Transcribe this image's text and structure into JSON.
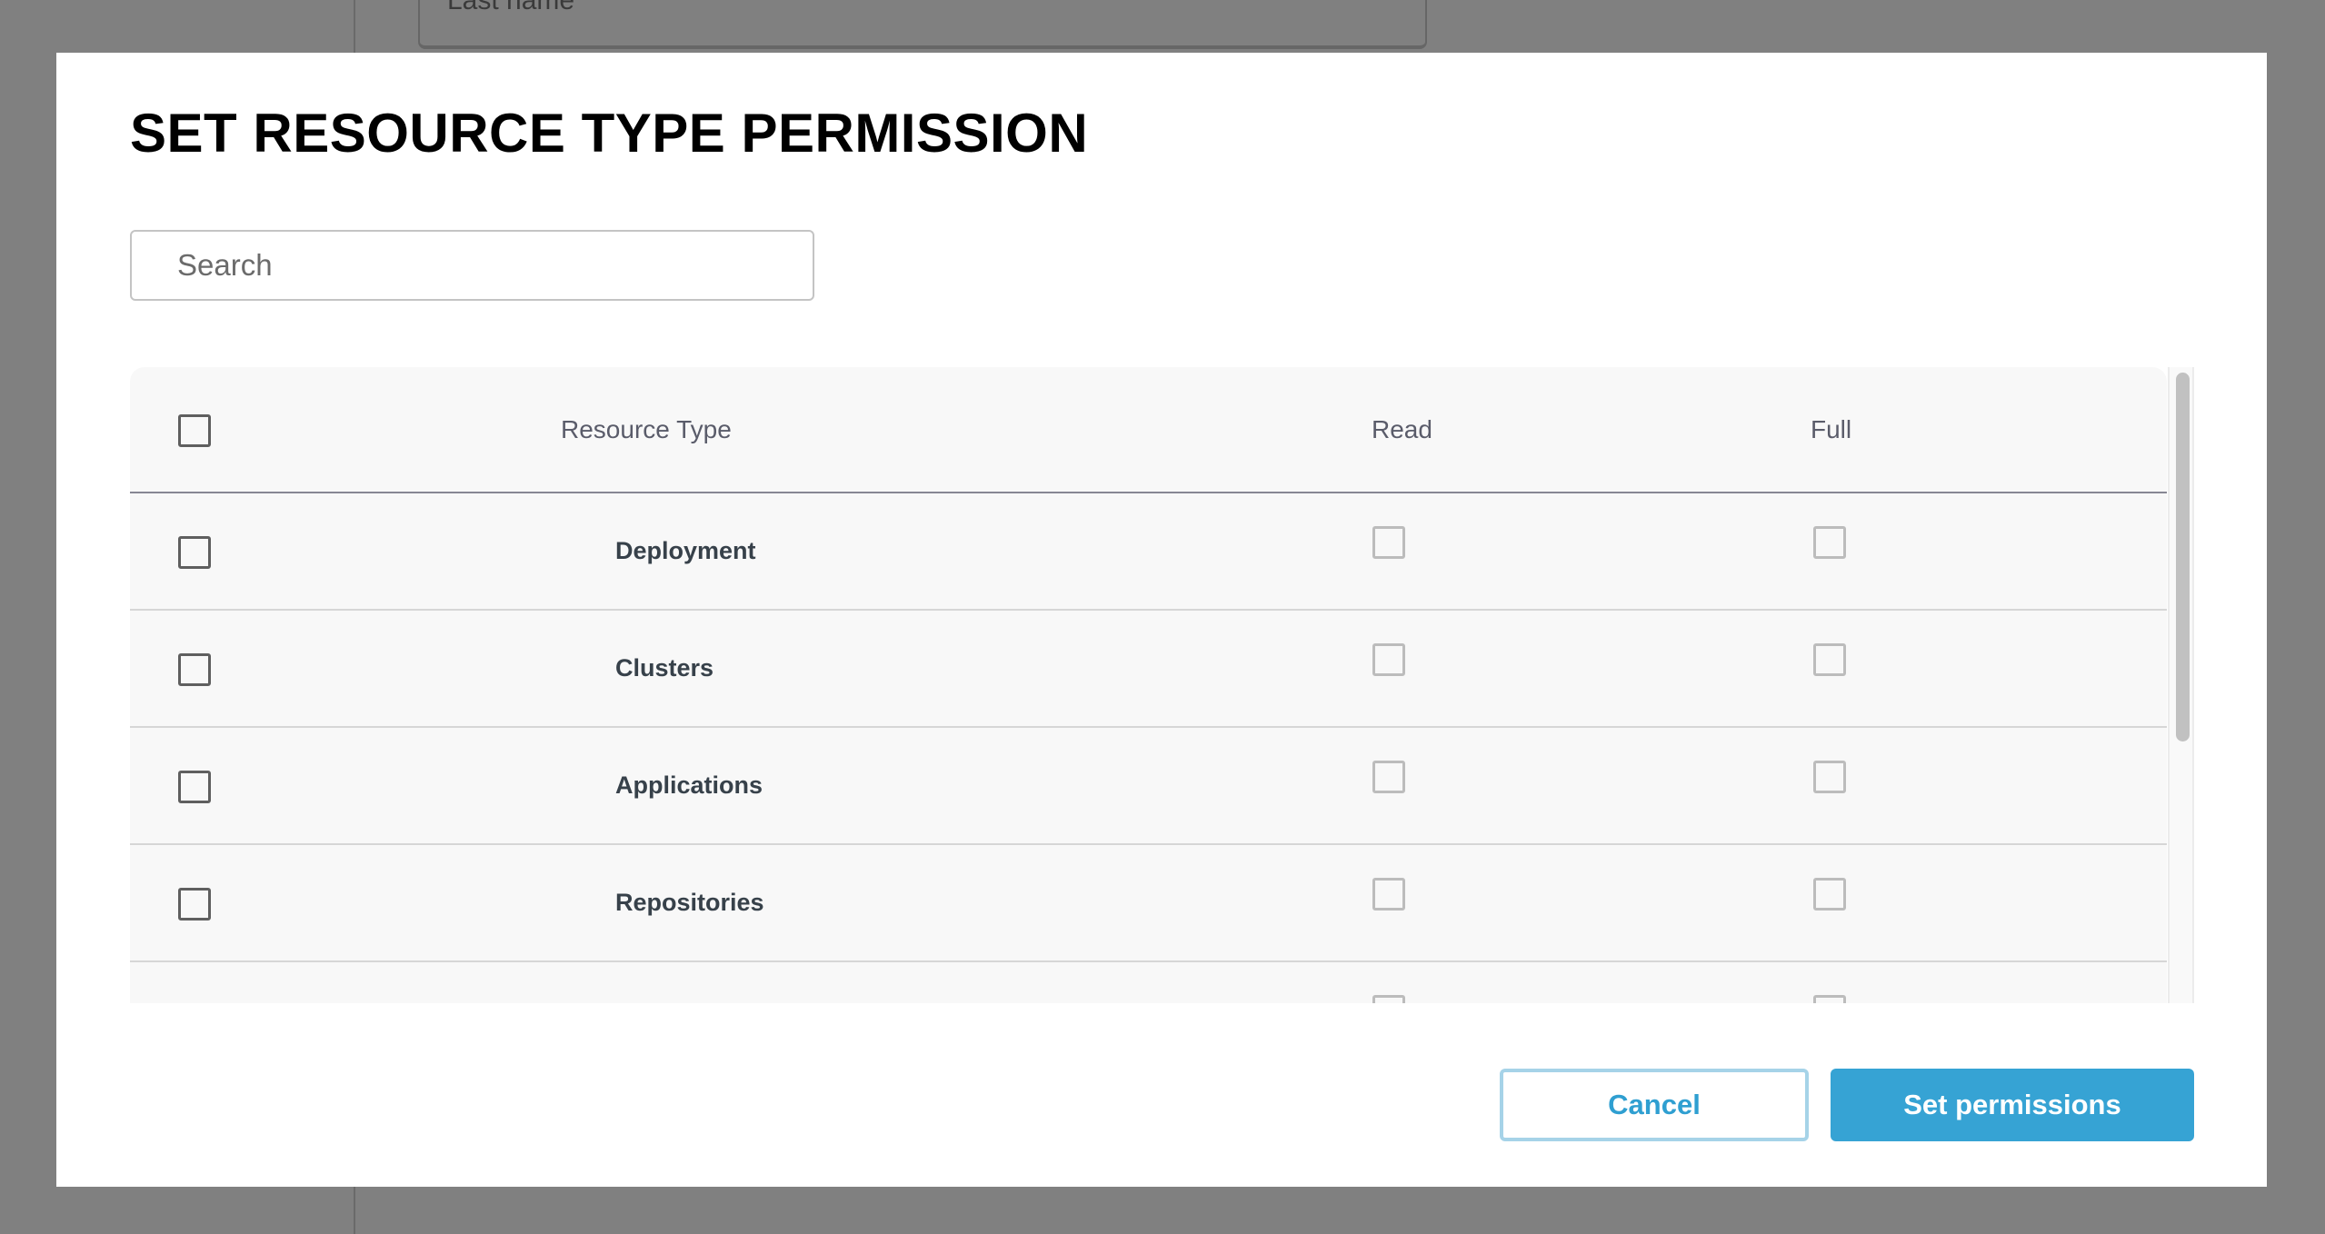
{
  "background": {
    "field_label": "Last name"
  },
  "modal": {
    "title": "SET RESOURCE TYPE PERMISSION",
    "search": {
      "placeholder": "Search",
      "value": ""
    },
    "table": {
      "columns": {
        "select_all": "",
        "resource_type": "Resource Type",
        "read": "Read",
        "full": "Full"
      },
      "rows": [
        {
          "resource_type": "Deployment",
          "selected": false,
          "read": false,
          "full": false
        },
        {
          "resource_type": "Clusters",
          "selected": false,
          "read": false,
          "full": false
        },
        {
          "resource_type": "Applications",
          "selected": false,
          "read": false,
          "full": false
        },
        {
          "resource_type": "Repositories",
          "selected": false,
          "read": false,
          "full": false
        },
        {
          "resource_type": "",
          "selected": false,
          "read": false,
          "full": false
        }
      ],
      "scroll_position": 0
    },
    "buttons": {
      "cancel": "Cancel",
      "submit": "Set permissions"
    }
  },
  "colors": {
    "overlay": "#808080",
    "primary": "#36a3d4",
    "cancel_text": "#2f9fd1",
    "cancel_border": "#a6d3e8",
    "table_bg": "#f8f8f8"
  }
}
